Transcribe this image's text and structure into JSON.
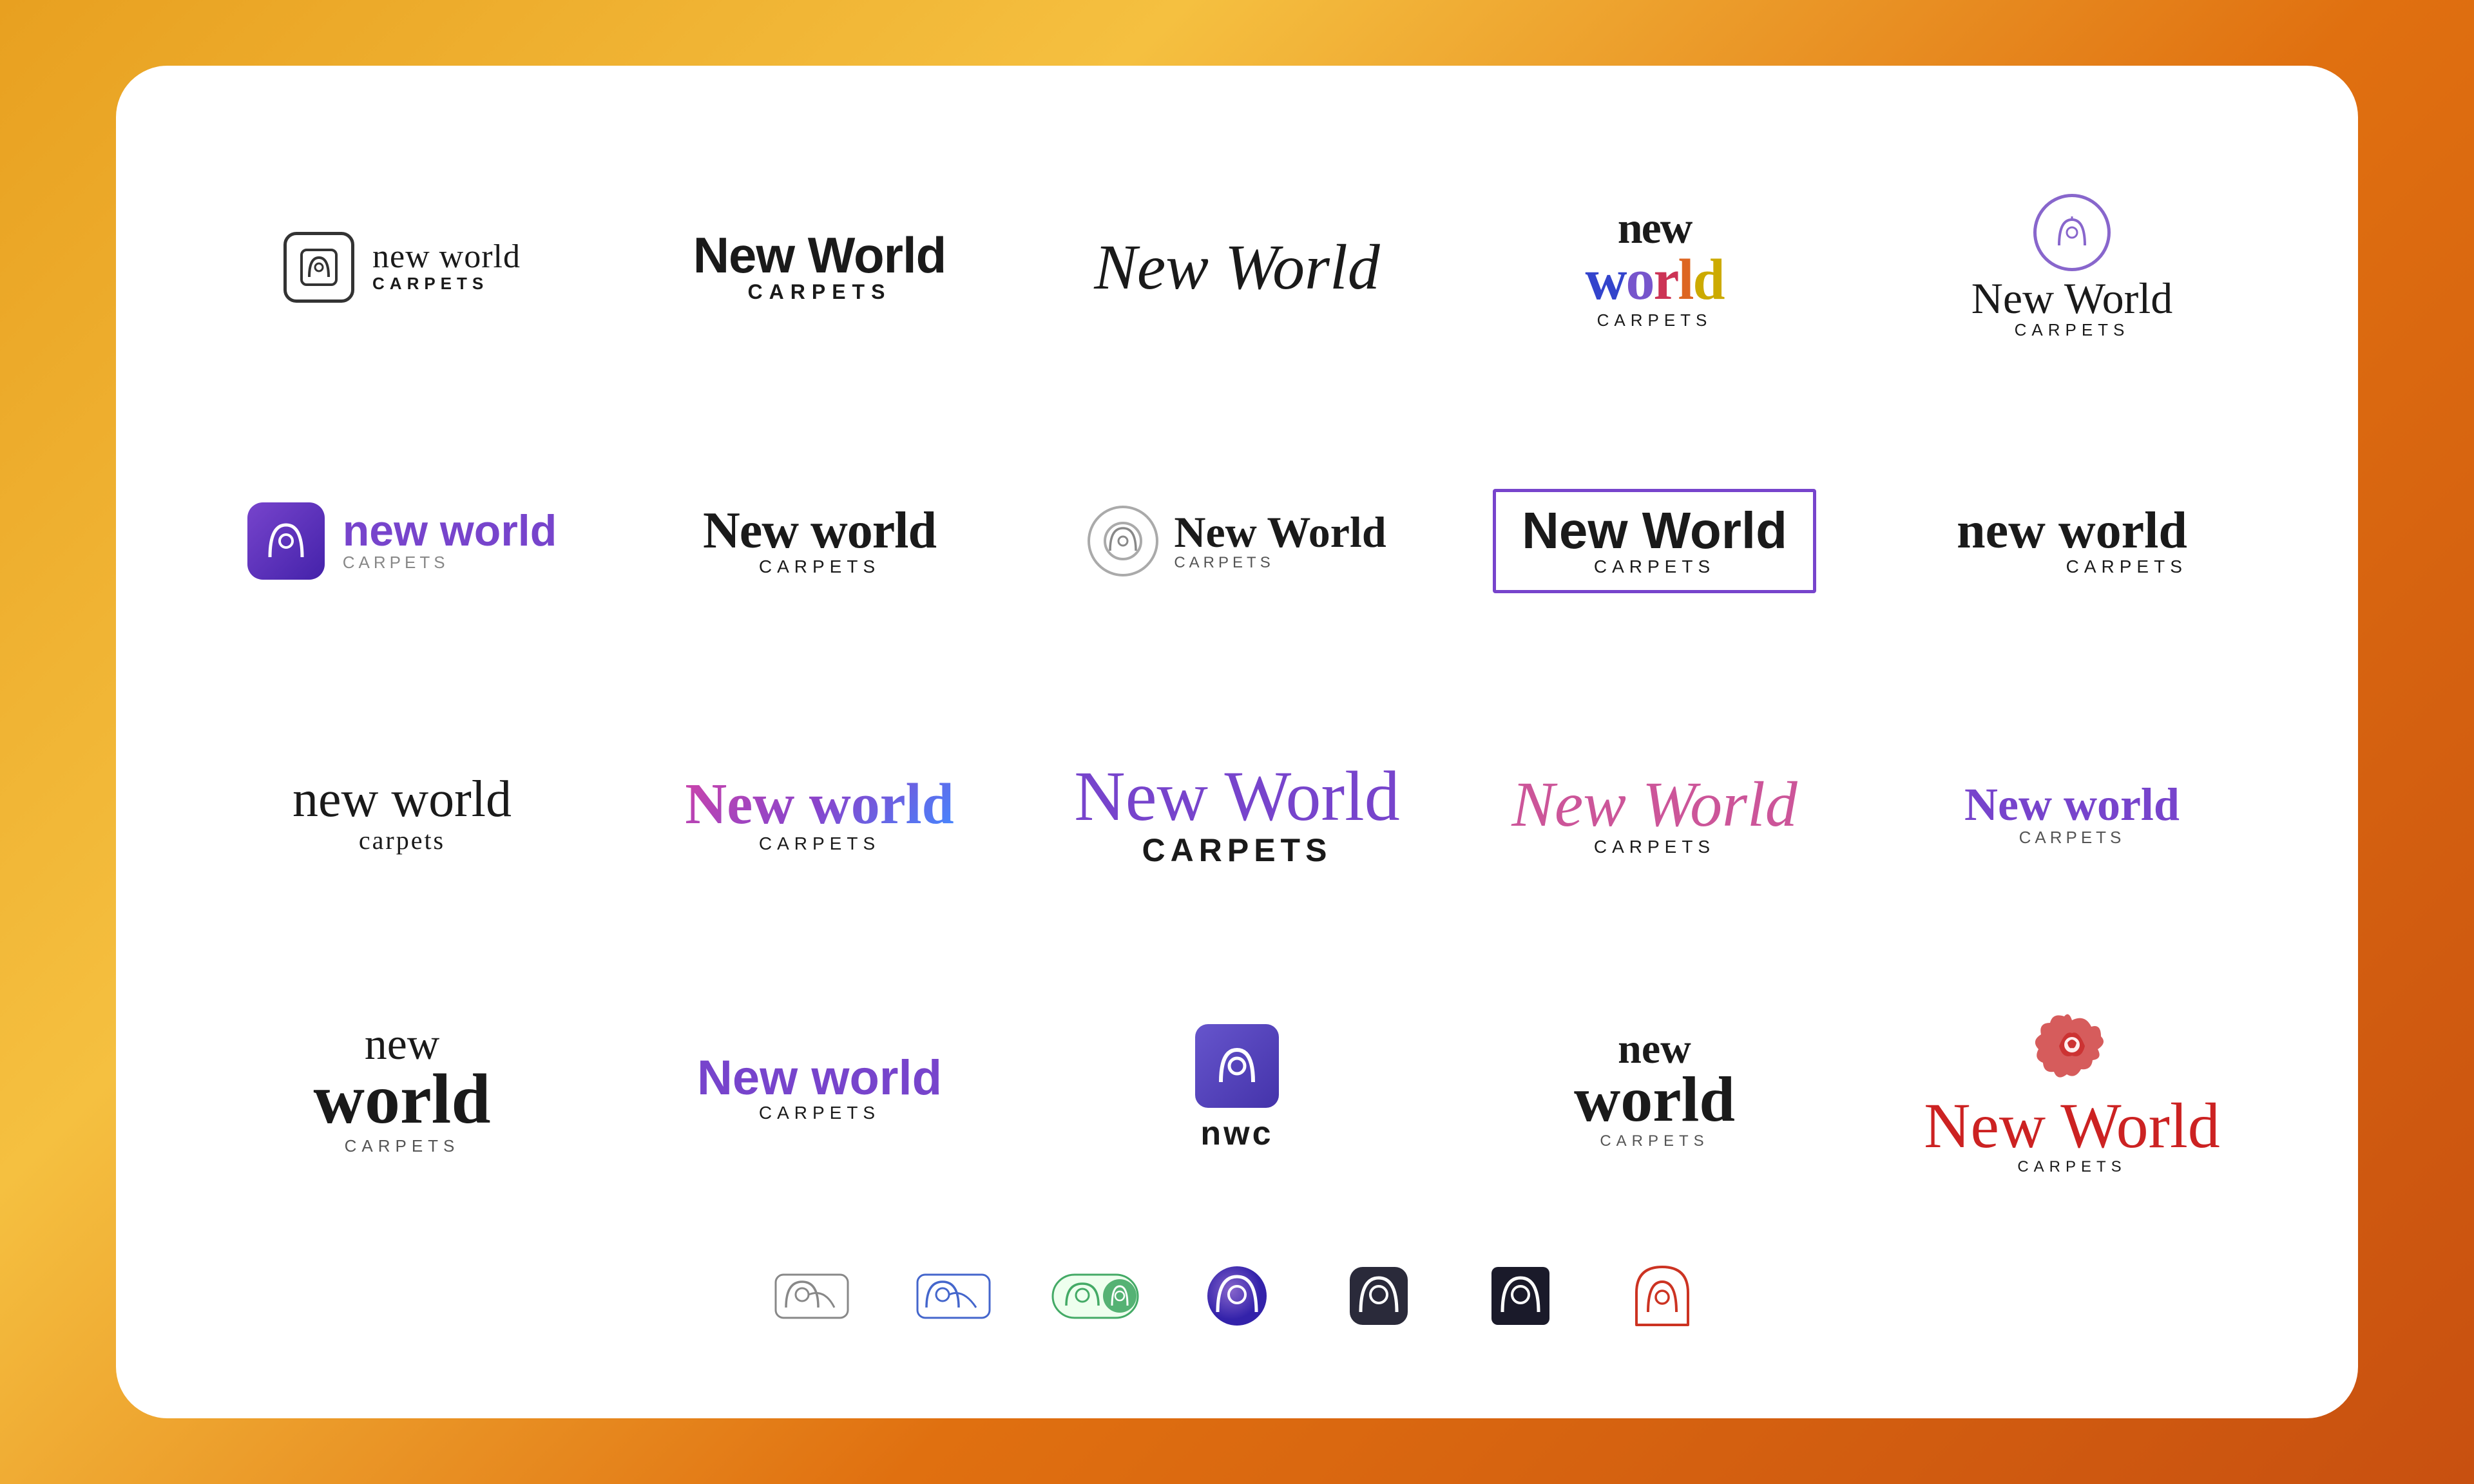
{
  "background": {
    "gradient_start": "#e8a020",
    "gradient_end": "#c85010"
  },
  "card": {
    "background": "#ffffff",
    "border_radius": "80px"
  },
  "logos": [
    {
      "id": 1,
      "line1": "new world",
      "line2": "carpets",
      "style": "icon-serif"
    },
    {
      "id": 2,
      "line1": "New World",
      "line2": "CARPETS",
      "style": "bold-sans"
    },
    {
      "id": 3,
      "line1": "New World",
      "style": "script"
    },
    {
      "id": 4,
      "line1": "new",
      "line2": "world",
      "line3": "CARPETS",
      "style": "colorful"
    },
    {
      "id": 5,
      "line1": "New World",
      "line2": "CARPETS",
      "style": "circle-icon"
    },
    {
      "id": 6,
      "line1": "new world",
      "line2": "carpets",
      "style": "purple-icon"
    },
    {
      "id": 7,
      "line1": "New world",
      "line2": "CARPETS",
      "style": "plain-serif"
    },
    {
      "id": 8,
      "line1": "New World",
      "line2": "CARPETS",
      "style": "badge-icon"
    },
    {
      "id": 9,
      "line1": "New World",
      "line2": "CARPETS",
      "style": "boxed"
    },
    {
      "id": 10,
      "line1": "new world",
      "line2": "CARPETS",
      "style": "minimal"
    },
    {
      "id": 11,
      "line1": "new world",
      "line2": "carpets",
      "style": "stacked"
    },
    {
      "id": 12,
      "line1": "New world",
      "line2": "CARPETS",
      "style": "gradient-script"
    },
    {
      "id": 13,
      "line1": "New World",
      "line2": "CARPETS",
      "style": "big-script-caps"
    },
    {
      "id": 14,
      "line1": "New World",
      "line2": "CARPETS",
      "style": "pink-script"
    },
    {
      "id": 15,
      "line1": "New world",
      "line2": "CARPETS",
      "style": "purple-sans"
    },
    {
      "id": 16,
      "line1": "new",
      "line2": "world",
      "line3": "carpets",
      "style": "large-stacked"
    },
    {
      "id": 17,
      "line1": "New world",
      "line2": "CARPETS",
      "style": "purple-bold"
    },
    {
      "id": 18,
      "icon": "nwc",
      "style": "icon-monogram"
    },
    {
      "id": 19,
      "line1": "new",
      "line2": "world",
      "line3": "CARPETS",
      "style": "bold-stacked"
    },
    {
      "id": 20,
      "line1": "New World",
      "line2": "CARPETS",
      "style": "red-script-icon"
    }
  ],
  "bottom_icons": [
    {
      "id": 1,
      "style": "outline-light"
    },
    {
      "id": 2,
      "style": "outline-blue"
    },
    {
      "id": 3,
      "style": "outline-green"
    },
    {
      "id": 4,
      "style": "circle-gradient"
    },
    {
      "id": 5,
      "style": "dark-rounded"
    },
    {
      "id": 6,
      "style": "dark-square"
    },
    {
      "id": 7,
      "style": "red-arch"
    }
  ]
}
